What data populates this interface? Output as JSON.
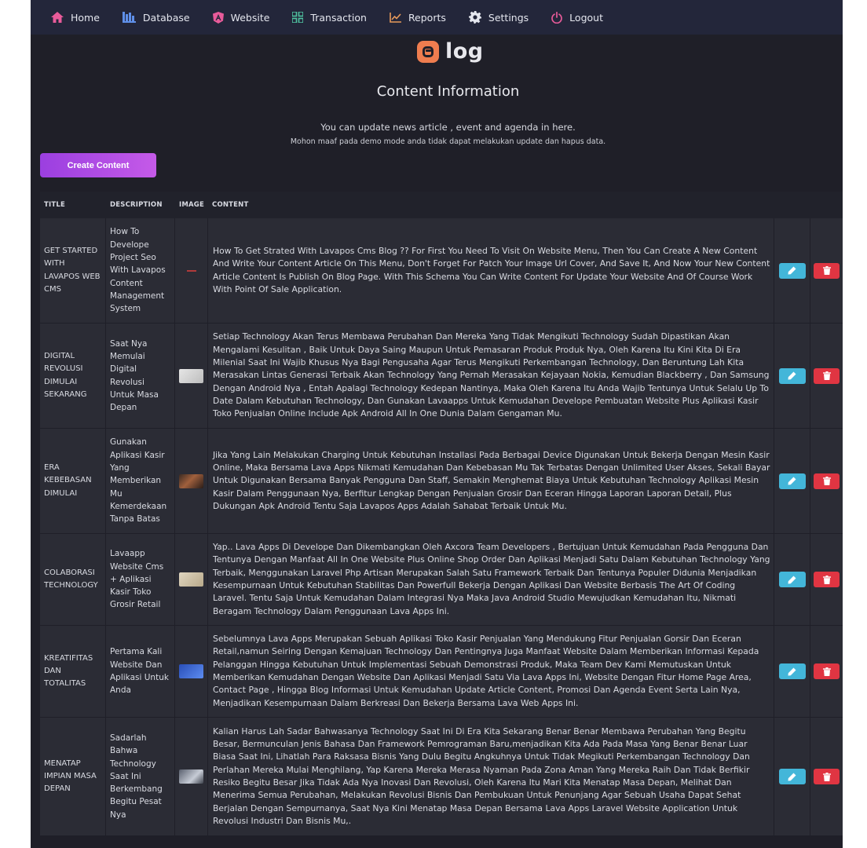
{
  "nav": {
    "items": [
      {
        "label": "Home",
        "icon": "home-icon",
        "color": "#e85b9a"
      },
      {
        "label": "Database",
        "icon": "database-icon",
        "color": "#5f8fe8"
      },
      {
        "label": "Website",
        "icon": "angular-icon",
        "color": "#e85b9a"
      },
      {
        "label": "Transaction",
        "icon": "grid-icon",
        "color": "#4fc3a1"
      },
      {
        "label": "Reports",
        "icon": "chart-icon",
        "color": "#e89a5b"
      },
      {
        "label": "Settings",
        "icon": "gear-icon",
        "color": "#e4e6ee"
      },
      {
        "label": "Logout",
        "icon": "power-icon",
        "color": "#e85b9a"
      }
    ]
  },
  "logo": {
    "text": "log",
    "accent": "#ef7d4f"
  },
  "page": {
    "title": "Content Information",
    "subtitle": "You can update news article , event and agenda in here.",
    "notice": "Mohon maaf pada demo mode anda tidak dapat melakukan update dan hapus data.",
    "create_button": "Create Content"
  },
  "table": {
    "headers": {
      "title": "TITLE",
      "description": "DESCRIPTION",
      "image": "IMAGE",
      "content": "CONTENT"
    },
    "rows": [
      {
        "title": "GET STARTED WITH LAVAPOS WEB CMS",
        "description": "How To Develope Project Seo With Lavapos Content Management System",
        "thumb_color": "#2b2c35",
        "content": "How To Get Strated With Lavapos Cms Blog ?? For First You Need To Visit On Website Menu, Then You Can Create A New Content And Write Your Content Article On This Menu, Don't Forget For Patch Your Image Url Cover, And Save It, And Now Your New Content Article Content Is Publish On Blog Page. With This Schema You Can Write Content For Update Your Website And Of Course Work With Point Of Sale Application."
      },
      {
        "title": "DIGITAL REVOLUSI DIMULAI SEKARANG",
        "description": "Saat Nya Memulai Digital Revolusi Untuk Masa Depan",
        "thumb_color": "#d9d9d9",
        "content": "Setiap Technology Akan Terus Membawa Perubahan Dan Mereka Yang Tidak Mengikuti Technology Sudah Dipastikan Akan Mengalami Kesulitan , Baik Untuk Daya Saing Maupun Untuk Pemasaran Produk Produk Nya, Oleh Karena Itu Kini Kita Di Era Milenial Saat Ini Wajib Khusus Nya Bagi Pengusaha Agar Terus Mengikuti Perkembangan Technology, Dan Beruntung Lah Kita Merasakan Lintas Generasi Terbaik Akan Technology Yang Pernah Merasakan Kejayaan Nokia, Kemudian Blackberry , Dan Samsung Dengan Android Nya , Entah Apalagi Technology Kedepan Nantinya, Maka Oleh Karena Itu Anda Wajib Tentunya Untuk Selalu Up To Date Dalam Kebutuhan Technology, Dan Gunakan Lavaapps Untuk Kemudahan Develope Pembuatan Website Plus Aplikasi Kasir Toko Penjualan Online Include Apk Android All In One Dunia Dalam Gengaman Mu."
      },
      {
        "title": "ERA KEBEBASAN DIMULAI",
        "description": "Gunakan Aplikasi Kasir Yang Memberikan Mu Kemerdekaan Tanpa Batas",
        "thumb_color": "#7a4a3a",
        "content": "Jika Yang Lain Melakukan Charging Untuk Kebutuhan Installasi Pada Berbagai Device Digunakan Untuk Bekerja Dengan Mesin Kasir Online, Maka Bersama Lava Apps Nikmati Kemudahan Dan Kebebasan Mu Tak Terbatas Dengan Unlimited User Akses, Sekali Bayar Untuk Digunakan Bersama Banyak Pengguna Dan Staff, Semakin Menghemat Biaya Untuk Kebutuhan Technology Aplikasi Mesin Kasir Dalam Penggunaan Nya, Berfitur Lengkap Dengan Penjualan Grosir Dan Eceran Hingga Laporan Laporan Detail, Plus Dukungan Apk Android Tentu Saja Lavapos Apps Adalah Sahabat Terbaik Untuk Mu."
      },
      {
        "title": "COLABORASI TECHNOLOGY",
        "description": "Lavaapp Website Cms + Aplikasi Kasir Toko Grosir Retail",
        "thumb_color": "#d9cfb8",
        "content": "Yap.. Lava Apps Di Develope Dan Dikembangkan Oleh Axcora Team Developers , Bertujuan Untuk Kemudahan Pada Pengguna Dan Tentunya Dengan Manfaat All In One Website Plus Online Shop Order Dan Aplikasi Menjadi Satu Dalam Kebutuhan Technology Yang Terbaik, Menggunakan Laravel Php Artisan Merupakan Salah Satu Framework Terbaik Dan Tentunya Populer Didunia Menjadikan Kesempurnaan Untuk Kebutuhan Stabilitas Dan Powerfull Bekerja Dengan Aplikasi Dan Website Berbasis The Art Of Coding Laravel. Tentu Saja Untuk Kemudahan Dalam Integrasi Nya Maka Java Android Studio Mewujudkan Kemudahan Itu, Nikmati Beragam Technology Dalam Penggunaan Lava Apps Ini."
      },
      {
        "title": "KREATIFITAS DAN TOTALITAS",
        "description": "Pertama Kali Website Dan Aplikasi Untuk Anda",
        "thumb_color": "#3b6fd9",
        "content": "Sebelumnya Lava Apps Merupakan Sebuah Aplikasi Toko Kasir Penjualan Yang Mendukung Fitur Penjualan Gorsir Dan Eceran Retail,namun Seiring Dengan Kemajuan Technology Dan Pentingnya Juga Manfaat Website Dalam Memberikan Informasi Kepada Pelanggan Hingga Kebutuhan Untuk Implementasi Sebuah Demonstrasi Produk, Maka Team Dev Kami Memutuskan Untuk Memberikan Kemudahan Dengan Website Dan Aplikasi Menjadi Satu Via Lava Apps Ini, Website Dengan Fitur Home Page Area, Contact Page , Hingga Blog Informasi Untuk Kemudahan Update Article Content, Promosi Dan Agenda Event Serta Lain Nya, Menjadikan Kesempurnaan Dalam Berkreasi Dan Bekerja Bersama Lava Web Apps Ini."
      },
      {
        "title": "MENATAP IMPIAN MASA DEPAN",
        "description": "Sadarlah Bahwa Technology Saat Ini Berkembang Begitu Pesat Nya",
        "thumb_color": "#9aa0ad",
        "content": "Kalian Harus Lah Sadar Bahwasanya Technology Saat Ini Di Era Kita Sekarang Benar Benar Membawa Perubahan Yang Begitu Besar, Bermunculan Jenis Bahasa Dan Framework Pemrograman Baru,menjadikan Kita Ada Pada Masa Yang Benar Benar Luar Biasa Saat Ini, Lihatlah Para Raksasa Bisnis Yang Dulu Begitu Angkuhnya Untuk Tidak Megikuti Perkembangan Technology Dan Perlahan Mereka Mulai Menghilang, Yap Karena Mereka Merasa Nyaman Pada Zona Aman Yang Mereka Raih Dan Tidak Berfikir Resiko Begitu Besar Jika Tidak Ada Nya Inovasi Dan Revolusi, Oleh Karena Itu Mari Kita Menatap Masa Depan, Melihat Dan Menerima Semua Perubahan, Melakukan Revolusi Bisnis Dan Pembukuan Untuk Penunjang Agar Sebuah Usaha Dapat Sehat Berjalan Dengan Sempurnanya, Saat Nya Kini Menatap Masa Depan Bersama Lava Apps Laravel Website Application Untuk Revolusi Industri Dan Bisnis Mu,."
      }
    ]
  },
  "colors": {
    "edit": "#43b6d9",
    "delete": "#e03542",
    "button_gradient_start": "#9b3fe0",
    "button_gradient_end": "#c55ae8"
  }
}
